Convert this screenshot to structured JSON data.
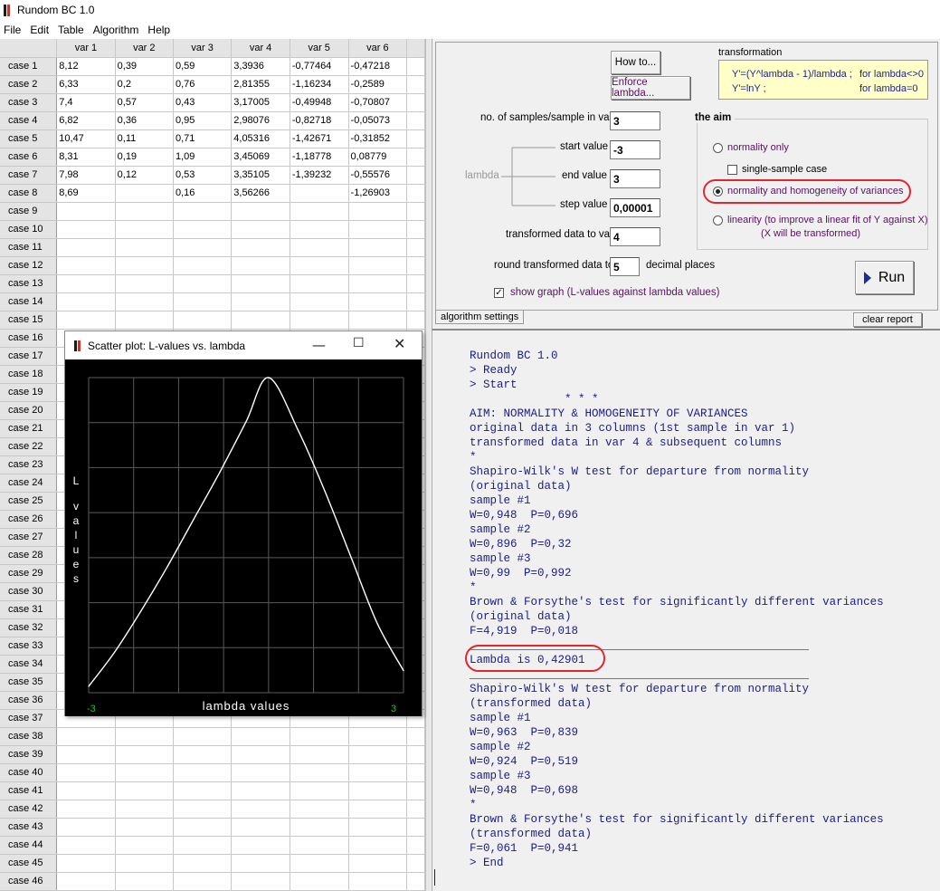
{
  "window": {
    "title": "Rundom BC 1.0"
  },
  "menu": [
    "File",
    "Edit",
    "Table",
    "Algorithm",
    "Help"
  ],
  "grid": {
    "columns": [
      "var 1",
      "var 2",
      "var 3",
      "var 4",
      "var 5",
      "var 6"
    ],
    "rows": [
      {
        "label": "case 1",
        "cells": [
          "8,12",
          "0,39",
          "0,59",
          "3,3936",
          "-0,77464",
          "-0,47218"
        ]
      },
      {
        "label": "case 2",
        "cells": [
          "6,33",
          "0,2",
          "0,76",
          "2,81355",
          "-1,16234",
          "-0,2589"
        ]
      },
      {
        "label": "case 3",
        "cells": [
          "7,4",
          "0,57",
          "0,43",
          "3,17005",
          "-0,49948",
          "-0,70807"
        ]
      },
      {
        "label": "case 4",
        "cells": [
          "6,82",
          "0,36",
          "0,95",
          "2,98076",
          "-0,82718",
          "-0,05073"
        ]
      },
      {
        "label": "case 5",
        "cells": [
          "10,47",
          "0,11",
          "0,71",
          "4,05316",
          "-1,42671",
          "-0,31852"
        ]
      },
      {
        "label": "case 6",
        "cells": [
          "8,31",
          "0,19",
          "1,09",
          "3,45069",
          "-1,18778",
          "0,08779"
        ]
      },
      {
        "label": "case 7",
        "cells": [
          "7,98",
          "0,12",
          "0,53",
          "3,35105",
          "-1,39232",
          "-0,55576"
        ]
      },
      {
        "label": "case 8",
        "cells": [
          "8,69",
          "",
          "0,16",
          "3,56266",
          "",
          "-1,26903"
        ]
      },
      {
        "label": "case 9",
        "cells": [
          "",
          "",
          "",
          "",
          "",
          ""
        ]
      },
      {
        "label": "case 10",
        "cells": [
          "",
          "",
          "",
          "",
          "",
          ""
        ]
      },
      {
        "label": "case 11",
        "cells": [
          "",
          "",
          "",
          "",
          "",
          ""
        ]
      },
      {
        "label": "case 12",
        "cells": [
          "",
          "",
          "",
          "",
          "",
          ""
        ]
      },
      {
        "label": "case 13",
        "cells": [
          "",
          "",
          "",
          "",
          "",
          ""
        ]
      },
      {
        "label": "case 14",
        "cells": [
          "",
          "",
          "",
          "",
          "",
          ""
        ]
      },
      {
        "label": "case 15",
        "cells": [
          "",
          "",
          "",
          "",
          "",
          ""
        ]
      },
      {
        "label": "case 16",
        "cells": [
          "",
          "",
          "",
          "",
          "",
          ""
        ]
      },
      {
        "label": "case 17",
        "cells": [
          "",
          "",
          "",
          "",
          "",
          ""
        ]
      },
      {
        "label": "case 18",
        "cells": [
          "",
          "",
          "",
          "",
          "",
          ""
        ]
      },
      {
        "label": "case 19",
        "cells": [
          "",
          "",
          "",
          "",
          "",
          ""
        ]
      },
      {
        "label": "case 20",
        "cells": [
          "",
          "",
          "",
          "",
          "",
          ""
        ]
      },
      {
        "label": "case 21",
        "cells": [
          "",
          "",
          "",
          "",
          "",
          ""
        ]
      },
      {
        "label": "case 22",
        "cells": [
          "",
          "",
          "",
          "",
          "",
          ""
        ]
      },
      {
        "label": "case 23",
        "cells": [
          "",
          "",
          "",
          "",
          "",
          ""
        ]
      },
      {
        "label": "case 24",
        "cells": [
          "",
          "",
          "",
          "",
          "",
          ""
        ]
      },
      {
        "label": "case 25",
        "cells": [
          "",
          "",
          "",
          "",
          "",
          ""
        ]
      },
      {
        "label": "case 26",
        "cells": [
          "",
          "",
          "",
          "",
          "",
          ""
        ]
      },
      {
        "label": "case 27",
        "cells": [
          "",
          "",
          "",
          "",
          "",
          ""
        ]
      },
      {
        "label": "case 28",
        "cells": [
          "",
          "",
          "",
          "",
          "",
          ""
        ]
      },
      {
        "label": "case 29",
        "cells": [
          "",
          "",
          "",
          "",
          "",
          ""
        ]
      },
      {
        "label": "case 30",
        "cells": [
          "",
          "",
          "",
          "",
          "",
          ""
        ]
      },
      {
        "label": "case 31",
        "cells": [
          "",
          "",
          "",
          "",
          "",
          ""
        ]
      },
      {
        "label": "case 32",
        "cells": [
          "",
          "",
          "",
          "",
          "",
          ""
        ]
      },
      {
        "label": "case 33",
        "cells": [
          "",
          "",
          "",
          "",
          "",
          ""
        ]
      },
      {
        "label": "case 34",
        "cells": [
          "",
          "",
          "",
          "",
          "",
          ""
        ]
      },
      {
        "label": "case 35",
        "cells": [
          "",
          "",
          "",
          "",
          "",
          ""
        ]
      },
      {
        "label": "case 36",
        "cells": [
          "",
          "",
          "",
          "",
          "",
          ""
        ]
      },
      {
        "label": "case 37",
        "cells": [
          "",
          "",
          "",
          "",
          "",
          ""
        ]
      },
      {
        "label": "case 38",
        "cells": [
          "",
          "",
          "",
          "",
          "",
          ""
        ]
      },
      {
        "label": "case 39",
        "cells": [
          "",
          "",
          "",
          "",
          "",
          ""
        ]
      },
      {
        "label": "case 40",
        "cells": [
          "",
          "",
          "",
          "",
          "",
          ""
        ]
      },
      {
        "label": "case 41",
        "cells": [
          "",
          "",
          "",
          "",
          "",
          ""
        ]
      },
      {
        "label": "case 42",
        "cells": [
          "",
          "",
          "",
          "",
          "",
          ""
        ]
      },
      {
        "label": "case 43",
        "cells": [
          "",
          "",
          "",
          "",
          "",
          ""
        ]
      },
      {
        "label": "case 44",
        "cells": [
          "",
          "",
          "",
          "",
          "",
          ""
        ]
      },
      {
        "label": "case 45",
        "cells": [
          "",
          "",
          "",
          "",
          "",
          ""
        ]
      },
      {
        "label": "case 46",
        "cells": [
          "",
          "",
          "",
          "",
          "",
          ""
        ]
      }
    ]
  },
  "settings": {
    "how_to_button": "How to...",
    "enforce_lambda_button": "Enforce lambda...",
    "transformation_title": "transformation",
    "formula1": "Y'=(Y^lambda - 1)/lambda ;",
    "formula1_cond": "for lambda<>0",
    "formula2": "Y'=lnY ;",
    "formula2_cond": "for lambda=0",
    "samples_label": "no. of samples/sample in var",
    "samples_value": "3",
    "lambda_label": "lambda",
    "start_label": "start value",
    "start_value": "-3",
    "end_label": "end value",
    "end_value": "3",
    "step_label": "step value",
    "step_value": "0,00001",
    "transformed_label": "transformed data to var",
    "transformed_value": "4",
    "round_label": "round transformed data to",
    "round_value": "5",
    "decimal_label": "decimal places",
    "show_graph_label": "show graph (L-values against lambda values)",
    "show_graph_checked": true,
    "aim_title": "the aim",
    "aim_normality": "normality only",
    "aim_single": "single-sample case",
    "aim_homogeneity": "normality and homogeneity of variances",
    "aim_linearity_1": "linearity (to improve a linear fit of Y against X)",
    "aim_linearity_2": "(X will be transformed)",
    "run_button": "Run",
    "algorithm_tab": "algorithm settings",
    "clear_report_button": "clear report"
  },
  "report": {
    "lines": [
      "Rundom BC 1.0",
      "> Ready",
      "> Start",
      "              * * *",
      "AIM: NORMALITY & HOMOGENEITY OF VARIANCES",
      "original data in 3 columns (1st sample in var 1)",
      "transformed data in var 4 & subsequent columns",
      "*",
      "Shapiro-Wilk's W test for departure from normality",
      "(original data)",
      "sample #1",
      "W=0,948  P=0,696",
      "sample #2",
      "W=0,896  P=0,32",
      "sample #3",
      "W=0,99  P=0,992",
      "*",
      "Brown & Forsythe's test for significantly different variances",
      "(original data)",
      "F=4,919  P=0,018",
      "__________________________________________________",
      "Lambda is 0,42901",
      "__________________________________________________",
      "Shapiro-Wilk's W test for departure from normality",
      "(transformed data)",
      "sample #1",
      "W=0,963  P=0,839",
      "sample #2",
      "W=0,924  P=0,519",
      "sample #3",
      "W=0,948  P=0,698",
      "*",
      "Brown & Forsythe's test for significantly different variances",
      "(transformed data)",
      "F=0,061  P=0,941",
      "> End"
    ]
  },
  "scatter": {
    "title": "Scatter plot:  L-values vs. lambda",
    "ylabel": "L values",
    "xlabel": "lambda values",
    "xmin_label": "-3",
    "xmax_label": "3"
  },
  "chart_data": {
    "type": "line",
    "x": [
      -3,
      -2.5,
      -2,
      -1.5,
      -1,
      -0.5,
      0,
      0.43,
      1,
      1.5,
      2,
      2.5,
      3
    ],
    "y": [
      0.02,
      0.13,
      0.26,
      0.4,
      0.55,
      0.7,
      0.86,
      1.0,
      0.83,
      0.64,
      0.43,
      0.22,
      0.07
    ],
    "xlim": [
      -3,
      3
    ],
    "ylim": [
      0,
      1
    ],
    "xlabel": "lambda values",
    "ylabel": "L values",
    "title": "Scatter plot:  L-values vs. lambda",
    "grid": true,
    "line_color": "#ffffff",
    "background": "#000000",
    "tick_label_color": "#21c21e"
  }
}
